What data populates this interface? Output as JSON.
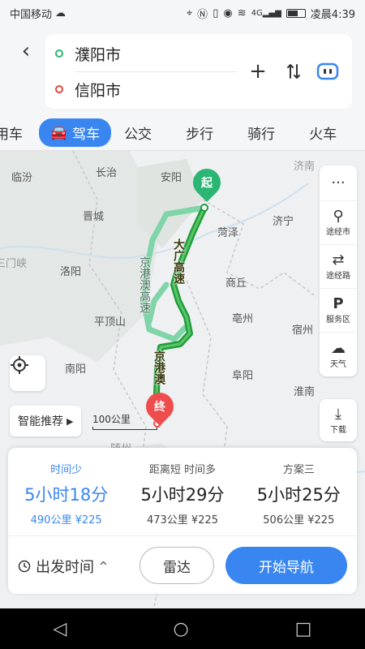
{
  "status_bar": {
    "carrier": "中国移动",
    "time": "凌晨4:39",
    "signal_label": "4G"
  },
  "route": {
    "start": "濮阳市",
    "end": "信阳市"
  },
  "tabs": [
    {
      "label": "用车",
      "active": false
    },
    {
      "label": "驾车",
      "active": true
    },
    {
      "label": "公交",
      "active": false
    },
    {
      "label": "步行",
      "active": false
    },
    {
      "label": "骑行",
      "active": false
    },
    {
      "label": "火车",
      "active": false
    }
  ],
  "map": {
    "cities": [
      {
        "name": "临汾"
      },
      {
        "name": "长治"
      },
      {
        "name": "安阳"
      },
      {
        "name": "济南"
      },
      {
        "name": "晋城"
      },
      {
        "name": "济宁"
      },
      {
        "name": "菏泽"
      },
      {
        "name": "三门峡"
      },
      {
        "name": "洛阳"
      },
      {
        "name": "商丘"
      },
      {
        "name": "平顶山"
      },
      {
        "name": "亳州"
      },
      {
        "name": "宿州"
      },
      {
        "name": "南阳"
      },
      {
        "name": "阜阳"
      },
      {
        "name": "淮南"
      },
      {
        "name": "随州"
      }
    ],
    "start_marker": "起",
    "end_marker": "终",
    "road_main": "大广高速",
    "road_main_lower": "京港澳",
    "road_alt": "京港澳高速",
    "scale": "100公里",
    "smart_recommend": "智能推荐",
    "side_tools": [
      "途经市",
      "途经路",
      "服务区",
      "天气"
    ],
    "download": "下载"
  },
  "plans": [
    {
      "tag": "时间少",
      "duration": "5小时18分",
      "distance": "490公里",
      "toll": "¥225",
      "selected": true
    },
    {
      "tag": "距离短  时间多",
      "duration": "5小时29分",
      "distance": "473公里",
      "toll": "¥225",
      "selected": false
    },
    {
      "tag": "方案三",
      "duration": "5小时25分",
      "distance": "506公里",
      "toll": "¥225",
      "selected": false
    }
  ],
  "actions": {
    "depart": "出发时间",
    "radar": "雷达",
    "start_nav": "开始导航"
  },
  "colors": {
    "accent": "#3a86f0",
    "route_main": "#1f9e3a",
    "route_alt": "#7fd4a8",
    "start_green": "#2bb673",
    "end_red": "#ef4d4d"
  }
}
